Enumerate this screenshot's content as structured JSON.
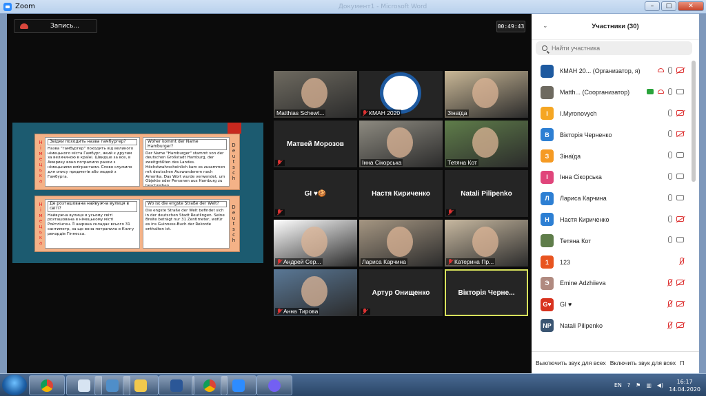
{
  "window": {
    "app_title": "Zoom",
    "ghost_title": "Документ1 - Microsoft Word"
  },
  "meeting": {
    "record_label": "Запись...",
    "timer": "00:49:43"
  },
  "slide": {
    "left_tab": "Німецька",
    "right_tab": "Deutsch",
    "cards": [
      {
        "uk_q": "Звідки походить назва гамбургер?",
        "uk_a": "Назва \"гамбургер\" походить від великого німецького міста Гамбург, який є другим за величиною в країні. Швидше за все, в Америку воно потрапило разом з німецькими емігрантами. Слово служило для опису предметів або людей з Гамбурга.",
        "de_q": "Woher kommt der Name Hamburger?",
        "de_a": "Der Name \"Hamburger\" stammt von der deutschen Großstadt Hamburg, der zweitgrößten des Landes. Höchstwahrscheinlich kam es zusammen mit deutschen Auswanderern nach Amerika. Das Wort wurde verwendet, um Objekte oder Personen aus Hamburg zu beschreiben."
      },
      {
        "uk_q": "Де розташована найвужча вулиця в світі?",
        "uk_a": "Найвужча вулиця в усьому світі розташована в німецькому місті Ройтлінген. Її ширина складає всього 31 сантиметр, за що вона потрапила в Книгу рекордів Гіннесса.",
        "de_q": "Wo ist die engste Straße der Welt?",
        "de_a": "Die engste Straße der Welt befindet sich in der deutschen Stadt Reutlingen. Seine Breite beträgt nur 31 Zentimeter, wofür es ins Guinness-Buch der Rekorde enthalten ist."
      }
    ]
  },
  "video_tiles": [
    {
      "caption": "Matthias Schewt...",
      "muted": false,
      "kind": "photo",
      "bg": "#6e6a60"
    },
    {
      "caption": "КМАН 2020",
      "muted": true,
      "kind": "logo",
      "bg": "#ffffff"
    },
    {
      "caption": "Зінаїда",
      "muted": false,
      "kind": "photo",
      "bg": "#c9b796"
    },
    {
      "caption": "",
      "name": "Матвей Морозов",
      "muted": true,
      "kind": "name"
    },
    {
      "caption": "Інна Сікорська",
      "muted": false,
      "kind": "photo",
      "bg": "#8d8a80"
    },
    {
      "caption": "Тетяна Кот",
      "muted": false,
      "kind": "photo",
      "bg": "#5f7d4a"
    },
    {
      "caption": "",
      "name": "GI ♥🍪",
      "muted": true,
      "kind": "name"
    },
    {
      "caption": "",
      "name": "Настя Кириченко",
      "muted": false,
      "kind": "name"
    },
    {
      "caption": "",
      "name": "Natali Pilipenko",
      "muted": true,
      "kind": "name"
    },
    {
      "caption": "Андрей Сер...",
      "muted": true,
      "kind": "photo",
      "bg": "#ffffff"
    },
    {
      "caption": "Лариса Карчина",
      "muted": false,
      "kind": "photo",
      "bg": "#a59682"
    },
    {
      "caption": "Катерина Пр...",
      "muted": true,
      "kind": "photo",
      "bg": "#c7b8a0"
    },
    {
      "caption": "Анна Тирова",
      "muted": true,
      "kind": "photo",
      "bg": "#5a7896"
    },
    {
      "caption": "",
      "name": "Артур Онищенко",
      "muted": true,
      "kind": "name"
    },
    {
      "caption": "",
      "name": "Вікторія Черне...",
      "muted": false,
      "kind": "name",
      "active": true
    }
  ],
  "participants_panel": {
    "title": "Участники (30)",
    "search_placeholder": "Найти участника",
    "items": [
      {
        "initials": "",
        "name": "КМАН 20...  (Организатор, я)",
        "color": "#1e5aa0",
        "mic": "on",
        "cam": "off",
        "extra": "rec"
      },
      {
        "initials": "",
        "name": "Matth... (Соорганизатор)",
        "color": "#6e6a60",
        "mic": "on",
        "cam": "on",
        "extra": "share_rec"
      },
      {
        "initials": "I",
        "name": "I.Myronovych",
        "color": "#f5a623",
        "mic": "on",
        "cam": "off",
        "extra": ""
      },
      {
        "initials": "В",
        "name": "Вікторія Черненко",
        "color": "#2d7fd3",
        "mic": "on",
        "cam": "off",
        "extra": ""
      },
      {
        "initials": "З",
        "name": "Зінаїда",
        "color": "#f59a23",
        "mic": "on",
        "cam": "on",
        "extra": ""
      },
      {
        "initials": "І",
        "name": "Інна Сікорська",
        "color": "#e0457b",
        "mic": "on",
        "cam": "on",
        "extra": ""
      },
      {
        "initials": "Л",
        "name": "Лариса Карчина",
        "color": "#2d7fd3",
        "mic": "on",
        "cam": "on",
        "extra": ""
      },
      {
        "initials": "Н",
        "name": "Настя Кириченко",
        "color": "#2d7fd3",
        "mic": "on",
        "cam": "off",
        "extra": ""
      },
      {
        "initials": "",
        "name": "Тетяна Кот",
        "color": "#5f7d4a",
        "mic": "on",
        "cam": "on",
        "extra": ""
      },
      {
        "initials": "1",
        "name": "123",
        "color": "#e8541f",
        "mic": "off",
        "cam": "",
        "extra": ""
      },
      {
        "initials": "Э",
        "name": "Emine Adzhiieva",
        "color": "#b08a80",
        "mic": "off",
        "cam": "off",
        "extra": ""
      },
      {
        "initials": "G♥",
        "name": "GI ♥",
        "color": "#d8331f",
        "mic": "off",
        "cam": "off",
        "extra": ""
      },
      {
        "initials": "NP",
        "name": "Natali Pilipenko",
        "color": "#3a5572",
        "mic": "off",
        "cam": "off",
        "extra": ""
      }
    ],
    "mute_all": "Выключить звук для всех",
    "unmute_all": "Включить звук для всех",
    "more": "П"
  },
  "taskbar": {
    "lang": "EN",
    "time": "16:17",
    "date": "14.04.2020"
  }
}
